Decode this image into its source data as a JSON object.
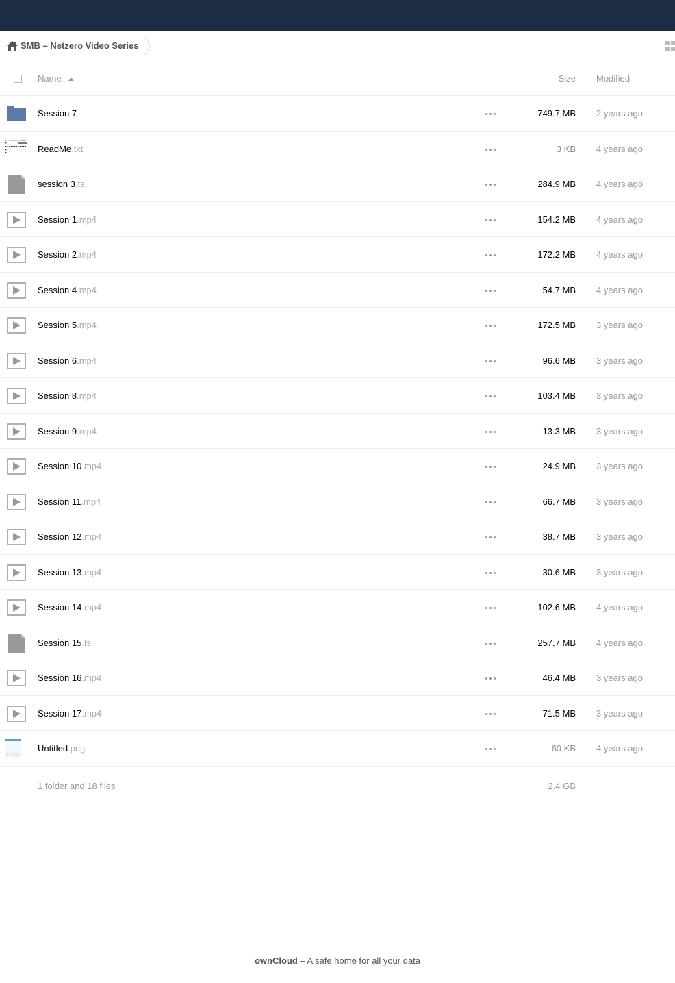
{
  "breadcrumb": {
    "label": "SMB – Netzero Video Series"
  },
  "header": {
    "name": "Name",
    "size": "Size",
    "modified": "Modified"
  },
  "files": [
    {
      "name": "Session 7",
      "ext": "",
      "type": "folder",
      "size": "749.7 MB",
      "modified": "2 years ago",
      "size_light": false
    },
    {
      "name": "ReadMe",
      "ext": ".txt",
      "type": "text",
      "size": "3 KB",
      "modified": "4 years ago",
      "size_light": true
    },
    {
      "name": "session 3",
      "ext": ".ts",
      "type": "generic",
      "size": "284.9 MB",
      "modified": "4 years ago",
      "size_light": false
    },
    {
      "name": "Session 1",
      "ext": ".mp4",
      "type": "video",
      "size": "154.2 MB",
      "modified": "4 years ago",
      "size_light": false
    },
    {
      "name": "Session 2",
      "ext": ".mp4",
      "type": "video",
      "size": "172.2 MB",
      "modified": "4 years ago",
      "size_light": false
    },
    {
      "name": "Session 4",
      "ext": ".mp4",
      "type": "video",
      "size": "54.7 MB",
      "modified": "4 years ago",
      "size_light": false
    },
    {
      "name": "Session 5",
      "ext": ".mp4",
      "type": "video",
      "size": "172.5 MB",
      "modified": "3 years ago",
      "size_light": false
    },
    {
      "name": "Session 6",
      "ext": ".mp4",
      "type": "video",
      "size": "96.6 MB",
      "modified": "3 years ago",
      "size_light": false
    },
    {
      "name": "Session 8",
      "ext": ".mp4",
      "type": "video",
      "size": "103.4 MB",
      "modified": "3 years ago",
      "size_light": false
    },
    {
      "name": "Session 9",
      "ext": ".mp4",
      "type": "video",
      "size": "13.3 MB",
      "modified": "3 years ago",
      "size_light": false
    },
    {
      "name": "Session 10",
      "ext": ".mp4",
      "type": "video",
      "size": "24.9 MB",
      "modified": "3 years ago",
      "size_light": false
    },
    {
      "name": "Session 11",
      "ext": ".mp4",
      "type": "video",
      "size": "66.7 MB",
      "modified": "3 years ago",
      "size_light": false
    },
    {
      "name": "Session 12",
      "ext": ".mp4",
      "type": "video",
      "size": "38.7 MB",
      "modified": "3 years ago",
      "size_light": false
    },
    {
      "name": "Session 13",
      "ext": ".mp4",
      "type": "video",
      "size": "30.6 MB",
      "modified": "3 years ago",
      "size_light": false
    },
    {
      "name": "Session 14",
      "ext": ".mp4",
      "type": "video",
      "size": "102.6 MB",
      "modified": "4 years ago",
      "size_light": false
    },
    {
      "name": "Session 15",
      "ext": ".ts",
      "type": "generic",
      "size": "257.7 MB",
      "modified": "4 years ago",
      "size_light": false
    },
    {
      "name": "Session 16",
      "ext": ".mp4",
      "type": "video",
      "size": "46.4 MB",
      "modified": "3 years ago",
      "size_light": false
    },
    {
      "name": "Session 17",
      "ext": ".mp4",
      "type": "video",
      "size": "71.5 MB",
      "modified": "3 years ago",
      "size_light": false
    },
    {
      "name": "Untitled",
      "ext": ".png",
      "type": "image",
      "size": "60 KB",
      "modified": "4 years ago",
      "size_light": true
    }
  ],
  "summary": {
    "count": "1 folder and 18 files",
    "total": "2.4 GB"
  },
  "footer": {
    "brand": "ownCloud",
    "tagline": " – A safe home for all your data"
  },
  "colors": {
    "topbar": "#1d2d44",
    "folder": "#5b7aa8",
    "file_grey": "#999999"
  },
  "icons": {
    "folder": "folder-icon",
    "text": "text-file-icon",
    "generic": "file-icon",
    "video": "video-file-icon",
    "image": "image-file-icon"
  }
}
